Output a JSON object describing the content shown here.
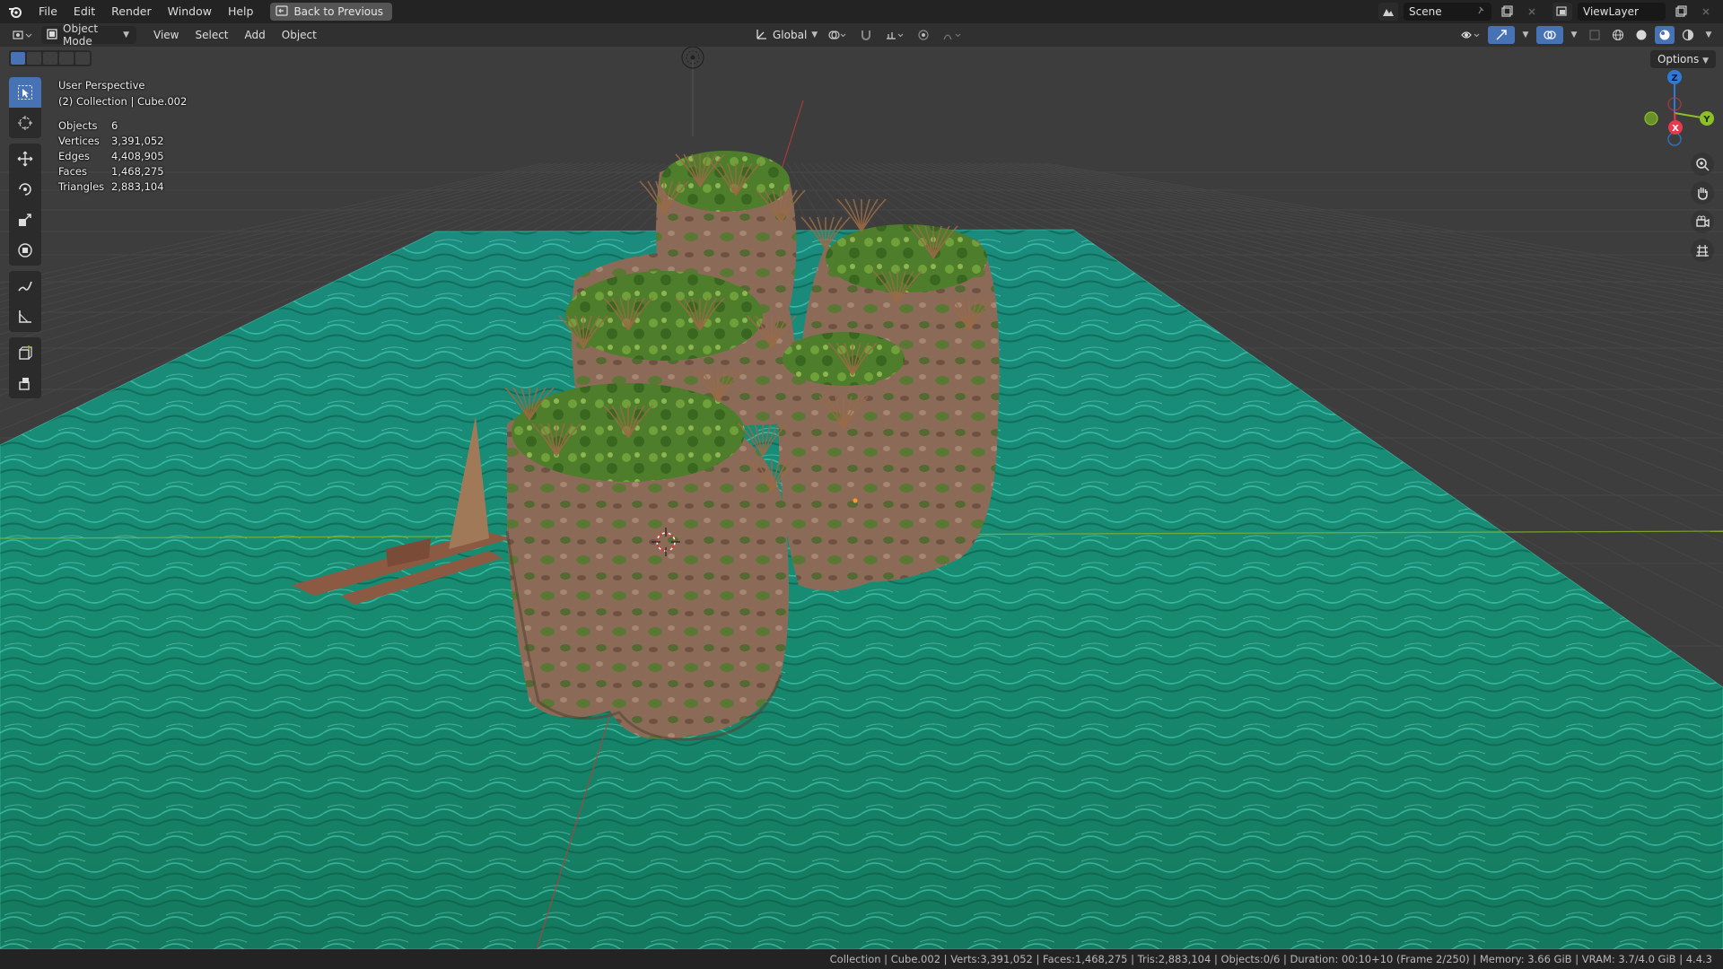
{
  "topbar": {
    "menus": [
      "File",
      "Edit",
      "Render",
      "Window",
      "Help"
    ],
    "back_button": "Back to Previous",
    "scene_name": "Scene",
    "view_layer": "ViewLayer"
  },
  "view_header": {
    "mode": "Object Mode",
    "menus": [
      "View",
      "Select",
      "Add",
      "Object"
    ],
    "orientation": "Global"
  },
  "viewport": {
    "options_label": "Options",
    "perspective": "User Perspective",
    "context": "(2) Collection | Cube.002",
    "stats": [
      {
        "label": "Objects",
        "value": "6"
      },
      {
        "label": "Vertices",
        "value": "3,391,052"
      },
      {
        "label": "Edges",
        "value": "4,408,905"
      },
      {
        "label": "Faces",
        "value": "1,468,275"
      },
      {
        "label": "Triangles",
        "value": "2,883,104"
      }
    ],
    "gizmo": {
      "z": "Z",
      "y": "Y",
      "x": "X"
    }
  },
  "toolbar": {
    "tools": [
      "select-box-icon",
      "cursor-icon",
      "move-icon",
      "rotate-icon",
      "scale-icon",
      "transform-icon",
      "annotate-icon",
      "measure-icon",
      "add-cube-icon",
      "extrude-icon"
    ]
  },
  "statusbar": {
    "text": "Collection | Cube.002 | Verts:3,391,052 | Faces:1,468,275 | Tris:2,883,104 | Objects:0/6 | Duration: 00:10+10 (Frame 2/250) | Memory: 3.66 GiB | VRAM: 3.7/4.0 GiB | 4.4.3"
  },
  "colors": {
    "accent": "#4772b3",
    "water": "#1f8a6e",
    "rock": "#8a6a55",
    "moss": "#4e7a2c",
    "axis_x": "#e63b4c",
    "axis_y": "#8dbf26",
    "axis_z": "#2d7bd6"
  }
}
